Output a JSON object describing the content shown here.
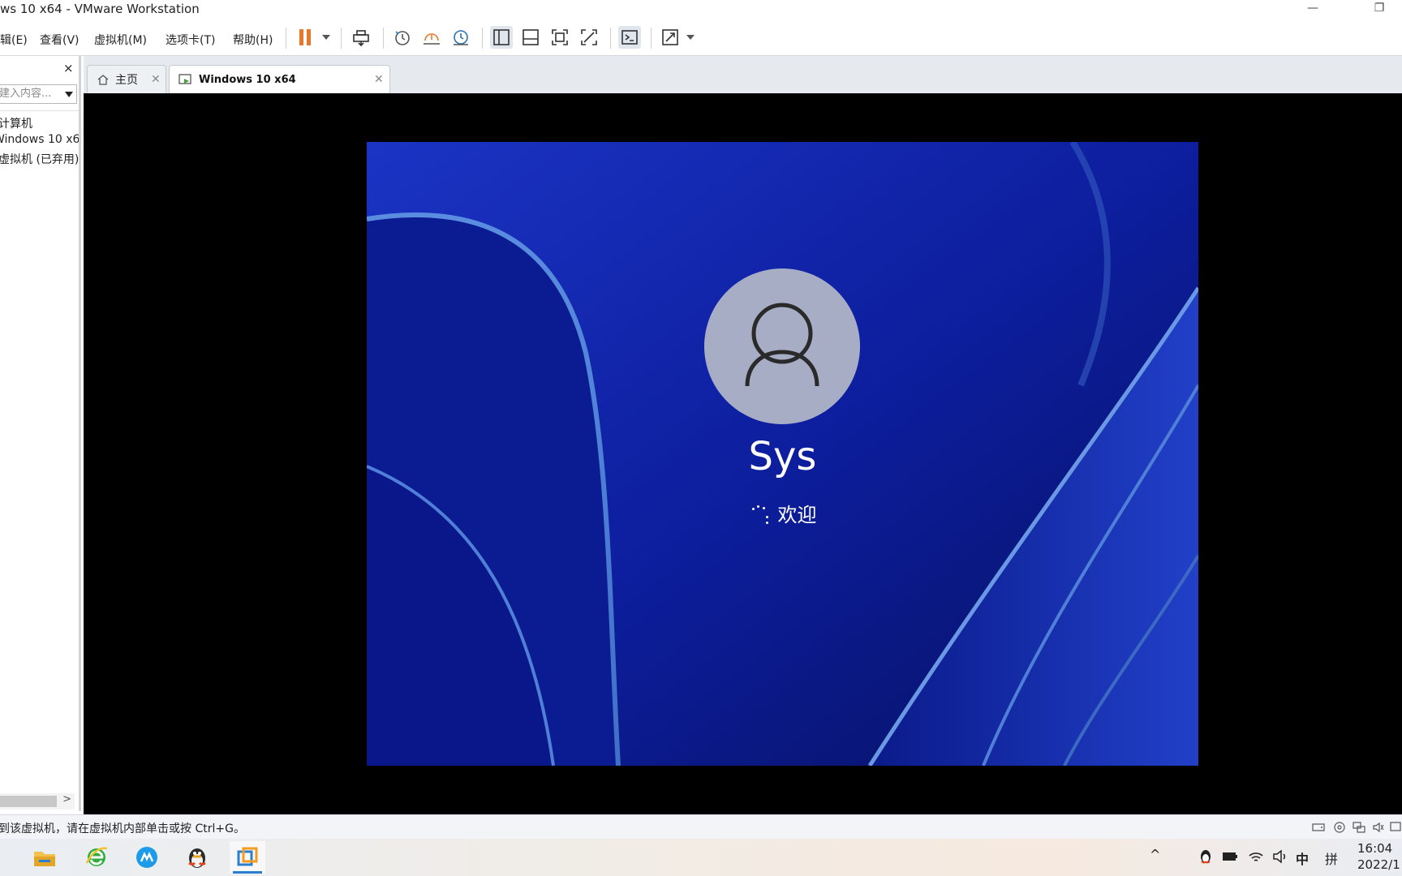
{
  "window": {
    "title": "ws 10 x64 - VMware Workstation",
    "minimize_glyph": "—",
    "restore_glyph": "❐"
  },
  "menu": {
    "items": [
      {
        "label": "辑(E)"
      },
      {
        "label": "查看(V)"
      },
      {
        "label": "虚拟机(M)"
      },
      {
        "label": "选项卡(T)"
      },
      {
        "label": "帮助(H)"
      }
    ]
  },
  "toolbar": {
    "icons": [
      "pause-icon",
      "send-ctrl-alt-del-icon",
      "snapshot-icon",
      "revert-snapshot-icon",
      "snapshot-manager-icon",
      "show-library-icon",
      "thumbnail-bar-icon",
      "full-screen-icon",
      "unity-icon",
      "console-view-icon",
      "stretch-guest-icon"
    ],
    "accent_color": "#e8762b"
  },
  "sidebar": {
    "close_glyph": "×",
    "search_placeholder": "建入内容...",
    "tree": [
      {
        "label": "计算机"
      },
      {
        "label": "Windows 10 x64"
      },
      {
        "label": "虚拟机 (已弃用)"
      }
    ]
  },
  "tabs": [
    {
      "label": "主页",
      "icon": "home-icon",
      "active": false
    },
    {
      "label": "Windows 10 x64",
      "icon": "vm-running-icon",
      "active": true
    }
  ],
  "guest": {
    "username": "Sys",
    "status": "欢迎",
    "background_color": "#0b1a8f"
  },
  "statusbar": {
    "message": "到该虚拟机，请在虚拟机内部单击或按 Ctrl+G。",
    "device_icons": [
      "hard-disk-icon",
      "cd-rom-icon",
      "network-adapter-icon",
      "sound-card-icon",
      "display-icon"
    ]
  },
  "taskbar": {
    "apps": [
      "file-explorer-icon",
      "ie-browser-icon",
      "app-blue-icon",
      "qq-penguin-icon",
      "vmware-icon"
    ],
    "tray": {
      "chevron": "^",
      "ime": "中",
      "ime_mode": "拼"
    },
    "clock": {
      "time": "16:04",
      "date": "2022/1"
    }
  }
}
